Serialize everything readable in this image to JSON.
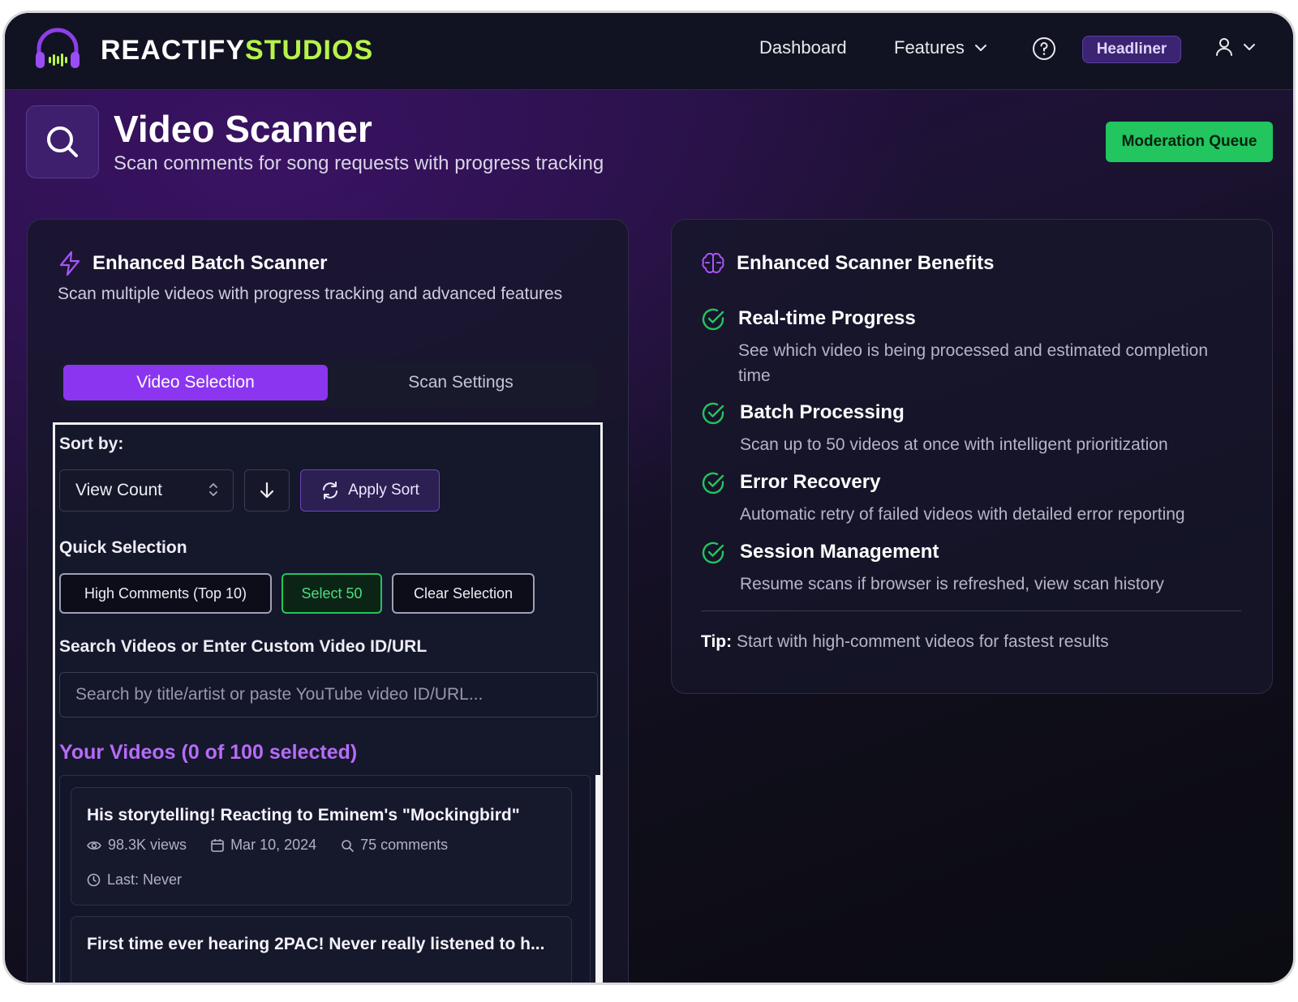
{
  "colors": {
    "accent_purple": "#8b35f0",
    "accent_green": "#22c55e",
    "brand_lime": "#b7f34a",
    "heading_purple": "#b56cf7",
    "background": "#111322"
  },
  "nav": {
    "brand_part1": "REACTIFY",
    "brand_part2": "STUDIOS",
    "dashboard": "Dashboard",
    "features": "Features",
    "badge": "Headliner",
    "icons": [
      "headphones-logo-icon",
      "chevron-down-icon",
      "help-icon",
      "user-icon"
    ]
  },
  "header": {
    "title": "Video Scanner",
    "subtitle": "Scan comments for song requests with progress tracking",
    "moderation_button": "Moderation Queue",
    "icon": "search-icon"
  },
  "batch_scanner": {
    "title": "Enhanced Batch Scanner",
    "description": "Scan multiple videos with progress tracking and advanced features",
    "tabs": [
      {
        "label": "Video Selection",
        "active": true
      },
      {
        "label": "Scan Settings",
        "active": false
      }
    ],
    "sort_label": "Sort by:",
    "sort_value": "View Count",
    "apply_sort": "Apply Sort",
    "quick_selection_label": "Quick Selection",
    "quick_buttons": [
      "High Comments (Top 10)",
      "Select 50",
      "Clear Selection"
    ],
    "search_label": "Search Videos or Enter Custom Video ID/URL",
    "search_placeholder": "Search by title/artist or paste YouTube video ID/URL...",
    "videos_heading": "Your Videos (0 of 100 selected)",
    "videos": [
      {
        "title": "His storytelling! Reacting to Eminem's \"Mockingbird\"",
        "views": "98.3K views",
        "date": "Mar 10, 2024",
        "comments": "75 comments",
        "last_scan": "Last: Never"
      },
      {
        "title": "First time ever hearing 2PAC! Never really listened to h..."
      }
    ]
  },
  "benefits": {
    "title": "Enhanced Scanner Benefits",
    "items": [
      {
        "title": "Real-time Progress",
        "description": "See which video is being processed and estimated completion time"
      },
      {
        "title": "Batch Processing",
        "description": "Scan up to 50 videos at once with intelligent prioritization"
      },
      {
        "title": "Error Recovery",
        "description": "Automatic retry of failed videos with detailed error reporting"
      },
      {
        "title": "Session Management",
        "description": "Resume scans if browser is refreshed, view scan history"
      }
    ],
    "tip_label": "Tip:",
    "tip_text": "Start with high-comment videos for fastest results"
  }
}
